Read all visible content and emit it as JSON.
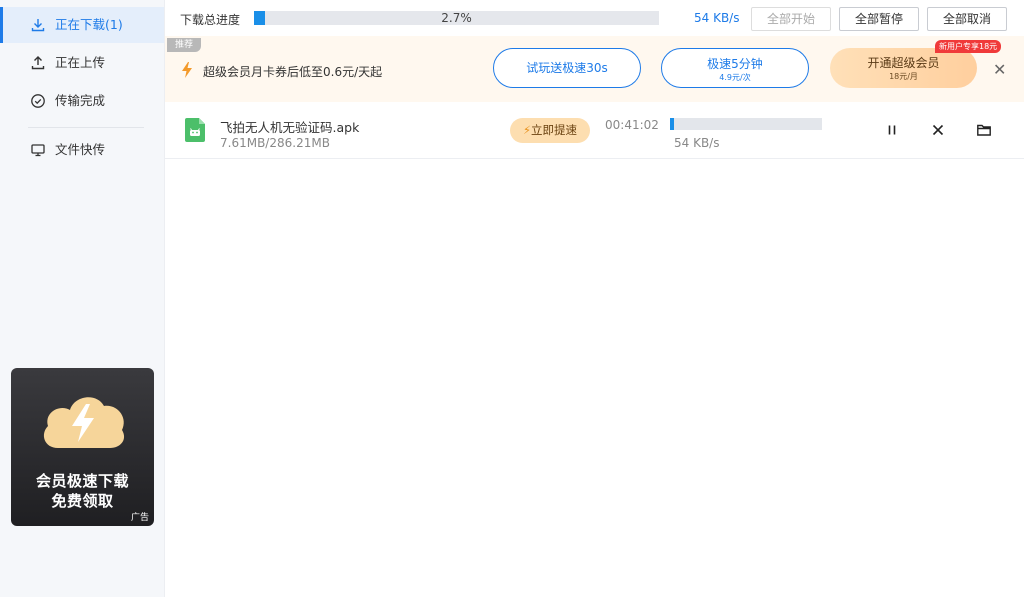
{
  "sidebar": {
    "items": [
      {
        "label": "正在下载(1)",
        "icon": "download-icon",
        "active": true
      },
      {
        "label": "正在上传",
        "icon": "upload-icon",
        "active": false
      },
      {
        "label": "传输完成",
        "icon": "check-circle-icon",
        "active": false
      },
      {
        "label": "文件快传",
        "icon": "monitor-icon",
        "active": false
      }
    ],
    "ad": {
      "line1": "会员极速下载",
      "line2": "免费领取",
      "tag": "广告"
    }
  },
  "topbar": {
    "total_progress_label": "下载总进度",
    "total_progress_text": "2.7%",
    "total_progress_fraction": 0.027,
    "speed": "54 KB/s",
    "start_all": "全部开始",
    "pause_all": "全部暂停",
    "cancel_all": "全部取消"
  },
  "promo": {
    "badge": "推荐",
    "text": "超级会员月卡券后低至0.6元/天起",
    "trial_button": "试玩送极速30s",
    "speed5_button": "极速5分钟",
    "speed5_price": "4.9元/次",
    "vip_button": "开通超级会员",
    "vip_price": "18元/月",
    "new_user_tag": "新用户专享18元",
    "accent": "#1e7be8"
  },
  "downloads": [
    {
      "name": "飞拍无人机无验证码.apk",
      "size": "7.61MB/286.21MB",
      "speedup_label": "立即提速",
      "eta": "00:41:02",
      "progress_fraction": 0.027,
      "speed": "54 KB/s",
      "icon": "apk-file-icon"
    }
  ]
}
